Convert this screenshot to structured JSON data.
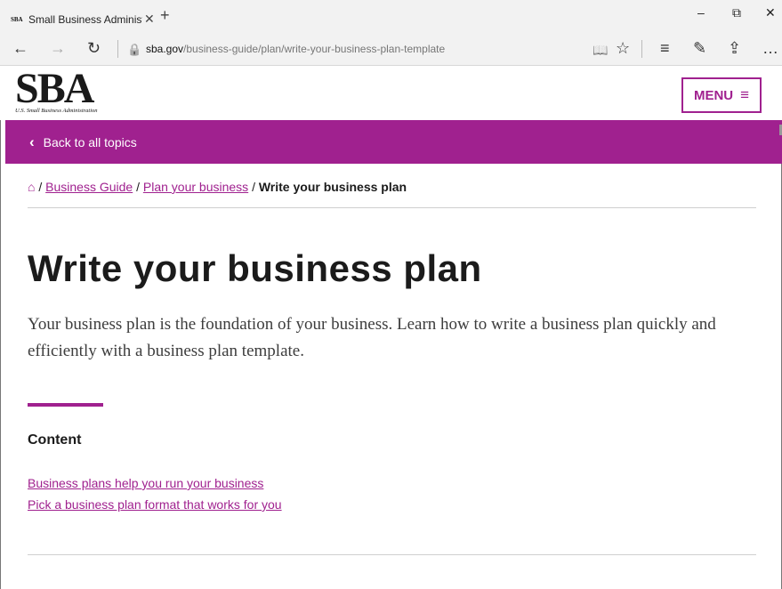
{
  "browser": {
    "tab_favicon": "SBA",
    "tab_title": "Small Business Administ",
    "tab_close": "✕",
    "new_tab": "+",
    "window_minimize": "–",
    "window_restore": "⧉",
    "window_close": "✕",
    "back": "←",
    "forward": "→",
    "refresh": "↻",
    "lock": "🔒",
    "url_domain": "sba.gov",
    "url_path": "/business-guide/plan/write-your-business-plan-template",
    "reading_view": "📖",
    "favorite": "☆",
    "hub": "≡",
    "web_note": "✎",
    "share": "⇪",
    "more": "…"
  },
  "header": {
    "logo_text": "SBA",
    "logo_subtitle": "U.S. Small Business Administration",
    "menu_label": "MENU",
    "menu_icon": "≡"
  },
  "topic_bar": {
    "back_icon": "‹",
    "label": "Back to all topics"
  },
  "breadcrumb": {
    "home_icon": "⌂",
    "sep": "/",
    "items": [
      "Business Guide",
      "Plan your business"
    ],
    "current": "Write your business plan"
  },
  "main": {
    "title": "Write your business plan",
    "lede": "Your business plan is the foundation of your business. Learn how to write a business plan quickly and efficiently with a business plan template.",
    "content_heading": "Content",
    "toc": [
      "Business plans help you run your business",
      "Pick a business plan format that works for you"
    ]
  },
  "colors": {
    "accent": "#a0218f",
    "text": "#1b1b1b",
    "lede": "#3d3d3d"
  }
}
